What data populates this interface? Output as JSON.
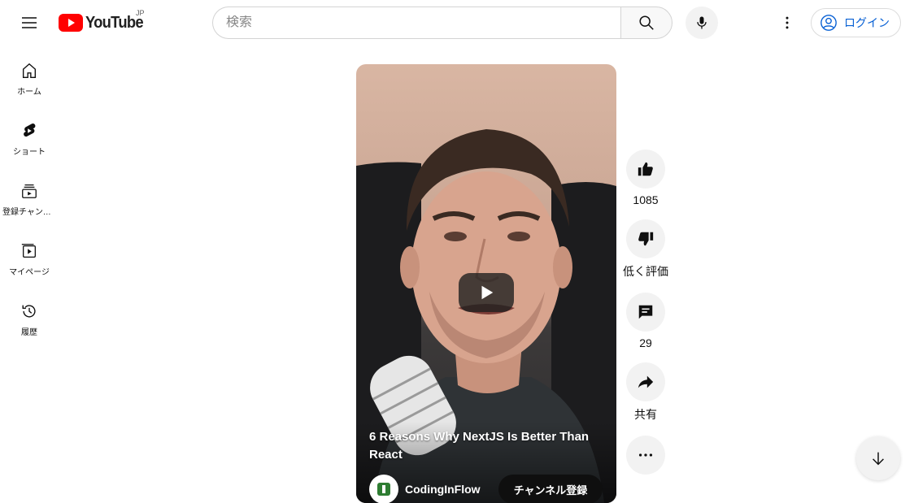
{
  "header": {
    "logo_text": "YouTube",
    "region": "JP",
    "search_placeholder": "検索",
    "signin_label": "ログイン"
  },
  "guide": {
    "items": [
      {
        "label": "ホーム",
        "icon": "home-icon"
      },
      {
        "label": "ショート",
        "icon": "shorts-icon"
      },
      {
        "label": "登録チャンネル",
        "icon": "subscriptions-icon"
      },
      {
        "label": "マイページ",
        "icon": "you-icon"
      },
      {
        "label": "履歴",
        "icon": "history-icon"
      }
    ]
  },
  "video": {
    "title": "6 Reasons Why NextJS Is Better Than React",
    "channel_name": "CodingInFlow",
    "subscribe_label": "チャンネル登録"
  },
  "actions": {
    "like_count": "1085",
    "dislike_label": "低く評価",
    "comments_count": "29",
    "share_label": "共有"
  },
  "colors": {
    "brand_red": "#ff0000",
    "link_blue": "#065fd4",
    "chip_bg": "#f2f2f2"
  }
}
